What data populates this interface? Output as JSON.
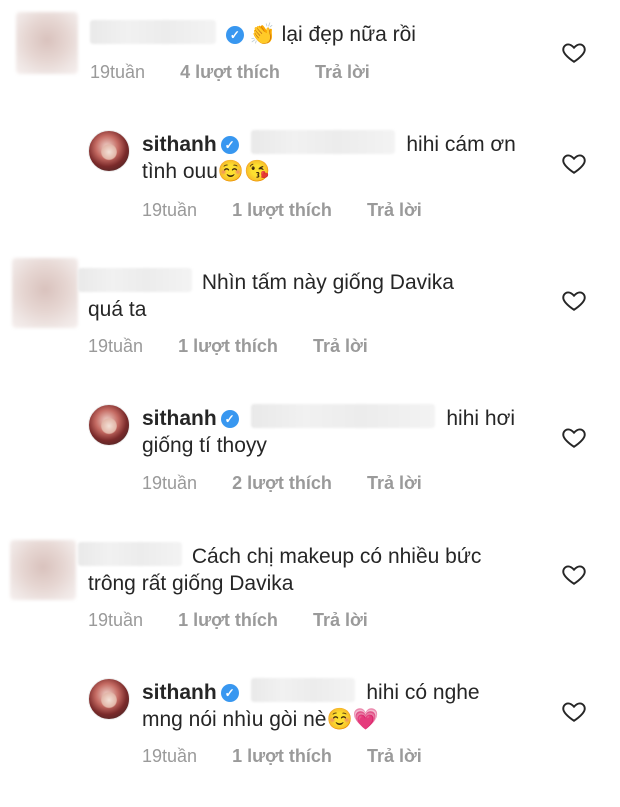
{
  "comments": [
    {
      "text": "👏 lại đẹp nữa rồi",
      "time": "19tuần",
      "likes": "4 lượt thích",
      "reply": "Trả lời"
    },
    {
      "username": "sithanh",
      "text_line1": "hihi cám ơn",
      "text_line2": "tình ouu☺️😘",
      "time": "19tuần",
      "likes": "1 lượt thích",
      "reply": "Trả lời"
    },
    {
      "text_line1": "Nhìn tấm này giống Davika",
      "text_line2": "quá ta",
      "time": "19tuần",
      "likes": "1 lượt thích",
      "reply": "Trả lời"
    },
    {
      "username": "sithanh",
      "text_line1": "hihi hơi",
      "text_line2": "giống tí thoyy",
      "time": "19tuần",
      "likes": "2 lượt thích",
      "reply": "Trả lời"
    },
    {
      "text_line1": "Cách chị makeup có nhiều bức",
      "text_line2": "trông rất giống Davika",
      "time": "19tuần",
      "likes": "1 lượt thích",
      "reply": "Trả lời"
    },
    {
      "username": "sithanh",
      "text_line1": "hihi có nghe",
      "text_line2": "mng nói nhìu gòi nè☺️💗",
      "time": "19tuần",
      "likes": "1 lượt thích",
      "reply": "Trả lời"
    }
  ],
  "icons": {
    "verified": "verified-badge-icon",
    "like": "heart-outline-icon"
  },
  "colors": {
    "verified": "#3897f0",
    "meta": "#9a9a9a",
    "text": "#262626"
  }
}
